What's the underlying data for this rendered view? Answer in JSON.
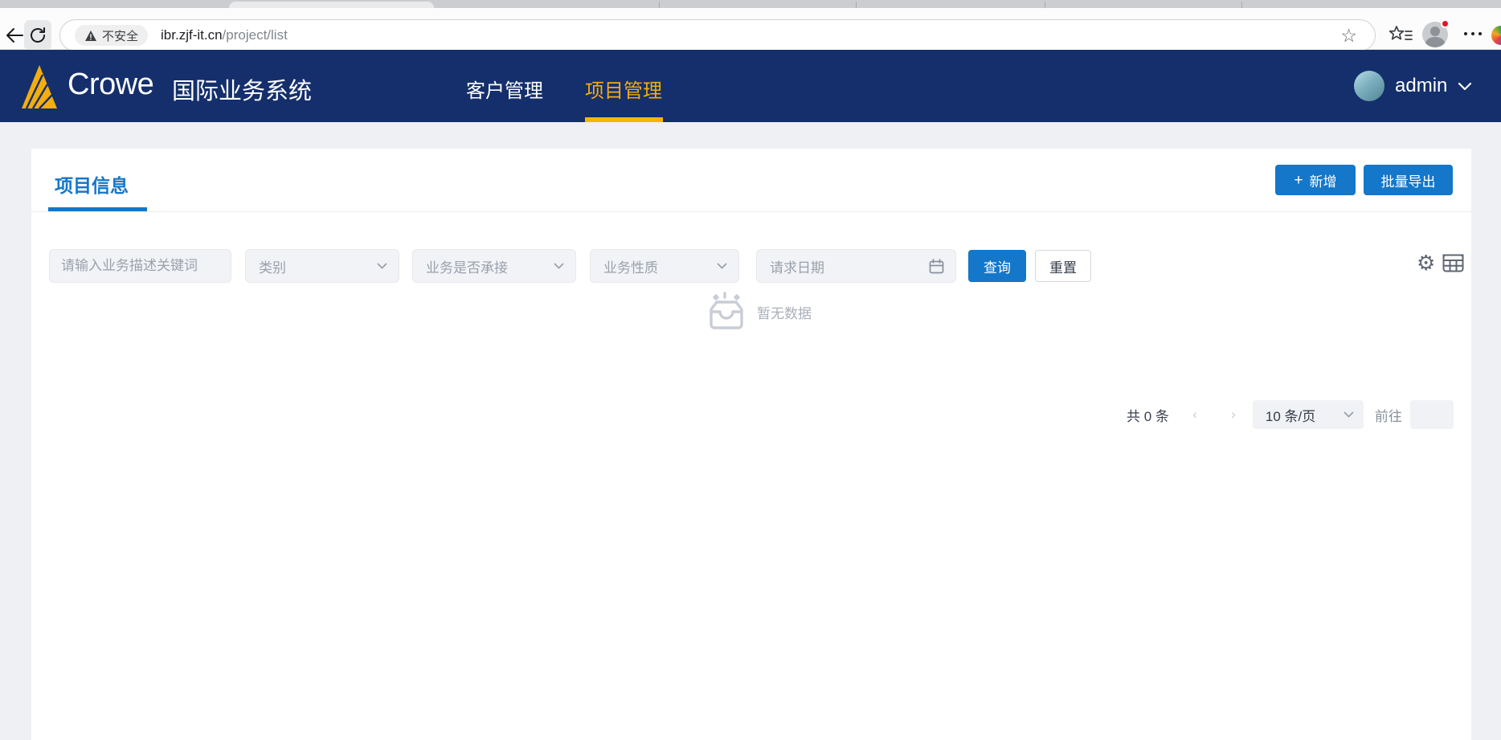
{
  "browser": {
    "security_badge": "不安全",
    "url_host": "ibr.zjf-it.cn",
    "url_path": "/project/list"
  },
  "navbar": {
    "brand": "Crowe",
    "system_name": "国际业务系统",
    "items": [
      {
        "label": "客户管理",
        "active": false
      },
      {
        "label": "项目管理",
        "active": true
      }
    ],
    "user": "admin"
  },
  "page": {
    "tab": "项目信息",
    "add_button": "新增",
    "export_button": "批量导出",
    "filters": {
      "keyword_placeholder": "请输入业务描述关键词",
      "category": "类别",
      "undertake": "业务是否承接",
      "nature": "业务性质",
      "request_date": "请求日期",
      "search": "查询",
      "reset": "重置"
    },
    "empty_text": "暂无数据",
    "pagination": {
      "total": "共 0 条",
      "prev": "‹",
      "next": "›",
      "page_size": "10 条/页",
      "goto": "前往"
    }
  },
  "icons": {
    "plus": "+",
    "gear": "⚙",
    "star": "☆"
  },
  "colors": {
    "navbar_navy": "#142F6B",
    "accent_blue": "#1477C9",
    "brand_gold": "#F3AD0E",
    "underline_gold": "#F6B600",
    "page_bg": "#EEF0F4"
  }
}
